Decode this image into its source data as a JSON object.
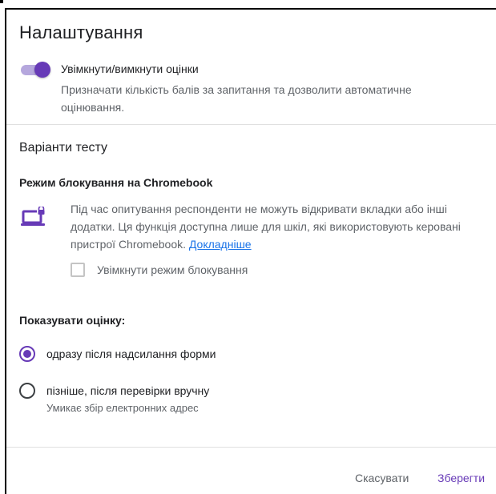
{
  "dialog": {
    "title": "Налаштування"
  },
  "grading": {
    "toggle_label": "Увімкнути/вимкнути оцінки",
    "toggle_description": "Призначати кількість балів за запитання та дозволити автоматичне оцінювання.",
    "enabled": true
  },
  "quiz_options": {
    "section_title": "Варіанти тесту",
    "lockdown": {
      "heading": "Режим блокування на Chromebook",
      "description": "Під час опитування респонденти не можуть відкривати вкладки або інші додатки. Ця функція доступна лише для шкіл, які використовують керовані пристрої Chromebook.",
      "learn_more": "Докладніше",
      "checkbox_label": "Увімкнути режим блокування",
      "checked": false
    },
    "release_grade": {
      "heading": "Показувати оцінку:",
      "options": [
        {
          "label": "одразу після надсилання форми",
          "sublabel": "",
          "selected": true
        },
        {
          "label": "пізніше, після перевірки вручну",
          "sublabel": "Умикає збір електронних адрес",
          "selected": false
        }
      ]
    }
  },
  "actions": {
    "cancel_label": "Скасувати",
    "save_label": "Зберегти"
  },
  "colors": {
    "accent": "#673ab7",
    "link": "#1a73e8",
    "secondary_text": "#5f6368"
  }
}
